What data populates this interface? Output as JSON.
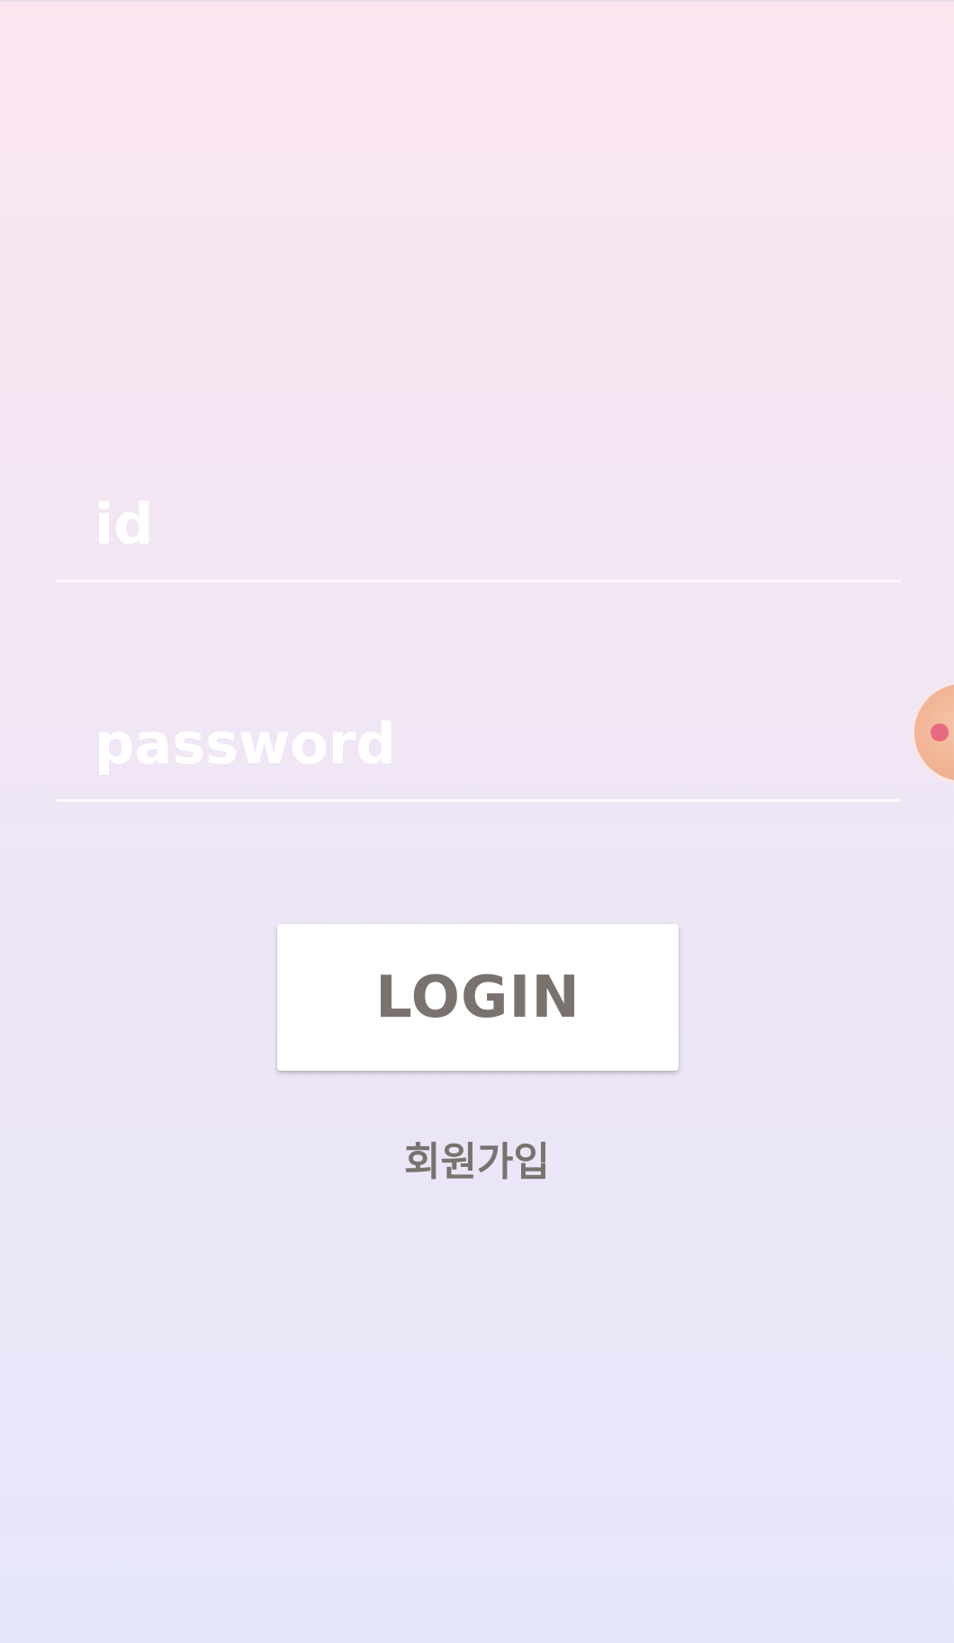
{
  "login_form": {
    "id_field": {
      "placeholder": "id",
      "value": ""
    },
    "password_field": {
      "placeholder": "password",
      "value": ""
    },
    "login_button_label": "LOGIN",
    "signup_link_label": "회원가입"
  },
  "floating_bubble": {
    "icon": "chat-head-bubble-icon",
    "color": "#f0b090",
    "dot_color": "#e86a80"
  },
  "colors": {
    "background_top": "#fbe6f0",
    "background_bottom": "#e6e6fa",
    "text_muted": "#7a726e",
    "button_background": "#ffffff",
    "field_text": "#ffffff"
  }
}
